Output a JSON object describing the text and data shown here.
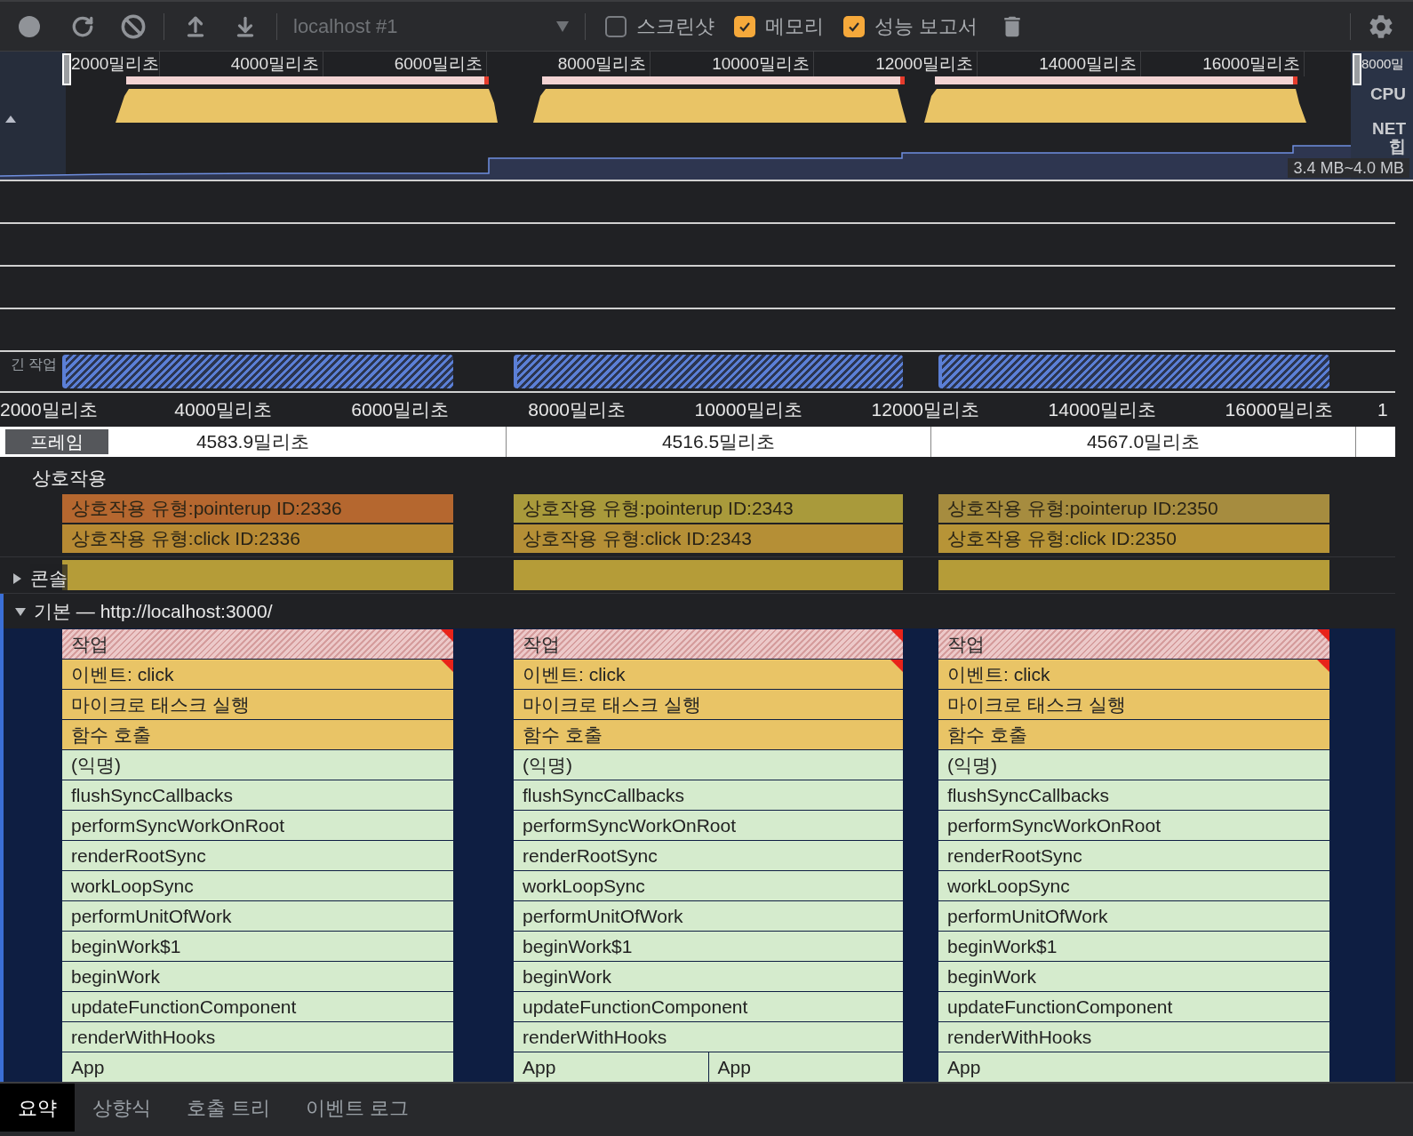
{
  "toolbar": {
    "target": "localhost #1",
    "options": [
      {
        "label": "스크린샷",
        "checked": false
      },
      {
        "label": "메모리",
        "checked": true
      },
      {
        "label": "성능 보고서",
        "checked": true
      }
    ]
  },
  "overview": {
    "ruler": [
      "2000밀리초",
      "4000밀리초",
      "6000밀리초",
      "8000밀리초",
      "10000밀리초",
      "12000밀리초",
      "14000밀리초",
      "16000밀리초"
    ],
    "edge_label": "8000밀",
    "tracks": [
      "CPU",
      "NET",
      "힙"
    ],
    "heap_range": "3.4 MB~4.0 MB"
  },
  "long_tasks": {
    "label": "긴 작업"
  },
  "timeline_ruler": [
    "2000밀리초",
    "4000밀리초",
    "6000밀리초",
    "8000밀리초",
    "10000밀리초",
    "12000밀리초",
    "14000밀리초",
    "16000밀리초",
    "1"
  ],
  "frames": {
    "label": "프레임",
    "durations": [
      "4583.9밀리초",
      "4516.5밀리초",
      "4567.0밀리초"
    ]
  },
  "interactions": {
    "title": "상호작용",
    "groups": [
      [
        {
          "label": "상호작용 유형:pointerup ID:2336",
          "color": "#b5672f"
        },
        {
          "label": "상호작용 유형:click ID:2336",
          "color": "#b78a33"
        }
      ],
      [
        {
          "label": "상호작용 유형:pointerup ID:2343",
          "color": "#a99a3b"
        },
        {
          "label": "상호작용 유형:click ID:2343",
          "color": "#b58f36"
        }
      ],
      [
        {
          "label": "상호작용 유형:pointerup ID:2350",
          "color": "#a68c3f"
        },
        {
          "label": "상호작용 유형:click ID:2350",
          "color": "#b79437"
        }
      ]
    ]
  },
  "console": {
    "label": "콘솔",
    "expanded": false
  },
  "main": {
    "label": "기본 — http://localhost:3000/",
    "expanded": true,
    "columns": [
      {
        "rows": [
          {
            "kind": "task",
            "warning": true,
            "cells": [
              "작업"
            ]
          },
          {
            "kind": "event",
            "warning": true,
            "cells": [
              "이벤트: click"
            ]
          },
          {
            "kind": "system",
            "warning": false,
            "cells": [
              "마이크로 태스크 실행"
            ]
          },
          {
            "kind": "system",
            "warning": false,
            "cells": [
              "함수 호출"
            ]
          },
          {
            "kind": "script",
            "warning": false,
            "cells": [
              "(익명)"
            ]
          },
          {
            "kind": "script",
            "warning": false,
            "cells": [
              "flushSyncCallbacks"
            ]
          },
          {
            "kind": "script",
            "warning": false,
            "cells": [
              "performSyncWorkOnRoot"
            ]
          },
          {
            "kind": "script",
            "warning": false,
            "cells": [
              "renderRootSync"
            ]
          },
          {
            "kind": "script",
            "warning": false,
            "cells": [
              "workLoopSync"
            ]
          },
          {
            "kind": "script",
            "warning": false,
            "cells": [
              "performUnitOfWork"
            ]
          },
          {
            "kind": "script",
            "warning": false,
            "cells": [
              "beginWork$1"
            ]
          },
          {
            "kind": "script",
            "warning": false,
            "cells": [
              "beginWork"
            ]
          },
          {
            "kind": "script",
            "warning": false,
            "cells": [
              "updateFunctionComponent"
            ]
          },
          {
            "kind": "script",
            "warning": false,
            "cells": [
              "renderWithHooks"
            ]
          },
          {
            "kind": "script",
            "warning": false,
            "cells": [
              "App"
            ]
          }
        ]
      },
      {
        "rows": [
          {
            "kind": "task",
            "warning": true,
            "cells": [
              "작업"
            ]
          },
          {
            "kind": "event",
            "warning": true,
            "cells": [
              "이벤트: click"
            ]
          },
          {
            "kind": "system",
            "warning": false,
            "cells": [
              "마이크로 태스크 실행"
            ]
          },
          {
            "kind": "system",
            "warning": false,
            "cells": [
              "함수 호출"
            ]
          },
          {
            "kind": "script",
            "warning": false,
            "cells": [
              "(익명)"
            ]
          },
          {
            "kind": "script",
            "warning": false,
            "cells": [
              "flushSyncCallbacks"
            ]
          },
          {
            "kind": "script",
            "warning": false,
            "cells": [
              "performSyncWorkOnRoot"
            ]
          },
          {
            "kind": "script",
            "warning": false,
            "cells": [
              "renderRootSync"
            ]
          },
          {
            "kind": "script",
            "warning": false,
            "cells": [
              "workLoopSync"
            ]
          },
          {
            "kind": "script",
            "warning": false,
            "cells": [
              "performUnitOfWork"
            ]
          },
          {
            "kind": "script",
            "warning": false,
            "cells": [
              "beginWork$1"
            ]
          },
          {
            "kind": "script",
            "warning": false,
            "cells": [
              "beginWork"
            ]
          },
          {
            "kind": "script",
            "warning": false,
            "cells": [
              "updateFunctionComponent"
            ]
          },
          {
            "kind": "script",
            "warning": false,
            "cells": [
              "renderWithHooks"
            ]
          },
          {
            "kind": "script",
            "warning": false,
            "cells": [
              "App",
              "App"
            ]
          }
        ]
      },
      {
        "rows": [
          {
            "kind": "task",
            "warning": true,
            "cells": [
              "작업"
            ]
          },
          {
            "kind": "event",
            "warning": true,
            "cells": [
              "이벤트: click"
            ]
          },
          {
            "kind": "system",
            "warning": false,
            "cells": [
              "마이크로 태스크 실행"
            ]
          },
          {
            "kind": "system",
            "warning": false,
            "cells": [
              "함수 호출"
            ]
          },
          {
            "kind": "script",
            "warning": false,
            "cells": [
              "(익명)"
            ]
          },
          {
            "kind": "script",
            "warning": false,
            "cells": [
              "flushSyncCallbacks"
            ]
          },
          {
            "kind": "script",
            "warning": false,
            "cells": [
              "performSyncWorkOnRoot"
            ]
          },
          {
            "kind": "script",
            "warning": false,
            "cells": [
              "renderRootSync"
            ]
          },
          {
            "kind": "script",
            "warning": false,
            "cells": [
              "workLoopSync"
            ]
          },
          {
            "kind": "script",
            "warning": false,
            "cells": [
              "performUnitOfWork"
            ]
          },
          {
            "kind": "script",
            "warning": false,
            "cells": [
              "beginWork$1"
            ]
          },
          {
            "kind": "script",
            "warning": false,
            "cells": [
              "beginWork"
            ]
          },
          {
            "kind": "script",
            "warning": false,
            "cells": [
              "updateFunctionComponent"
            ]
          },
          {
            "kind": "script",
            "warning": false,
            "cells": [
              "renderWithHooks"
            ]
          },
          {
            "kind": "script",
            "warning": false,
            "cells": [
              "App"
            ]
          }
        ]
      }
    ]
  },
  "tabs": [
    {
      "label": "요약",
      "selected": true
    },
    {
      "label": "상향식",
      "selected": false
    },
    {
      "label": "호출 트리",
      "selected": false
    },
    {
      "label": "이벤트 로그",
      "selected": false
    }
  ]
}
